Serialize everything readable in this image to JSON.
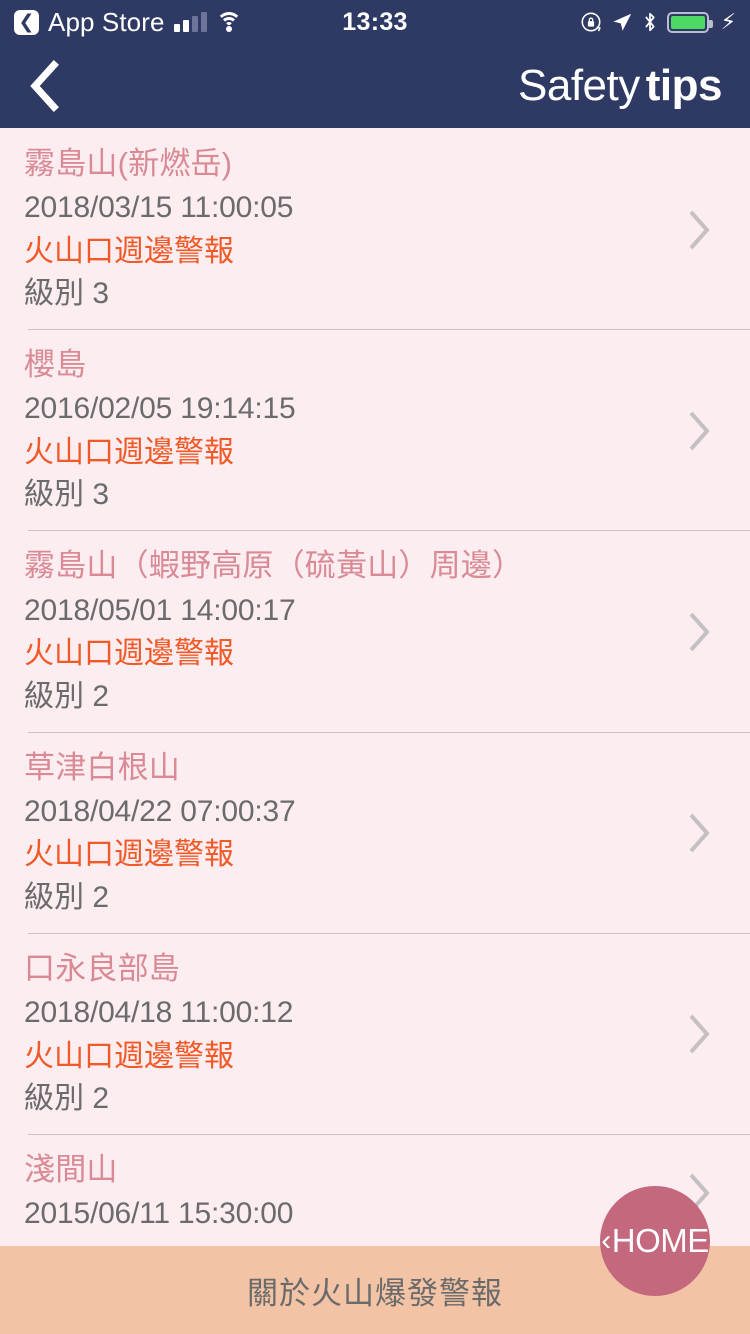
{
  "status_bar": {
    "back_app_label": "App Store",
    "back_chip_icon": "chevron-left-icon",
    "clock": "13:33",
    "signal_icon": "cellular-signal-icon",
    "wifi_icon": "wifi-icon",
    "rotation_lock_icon": "rotation-lock-icon",
    "location_icon": "location-arrow-icon",
    "bluetooth_icon": "bluetooth-icon",
    "battery_icon": "battery-icon",
    "charging_icon": "lightning-bolt-icon",
    "battery_color": "#4cd964",
    "bar_color": "#2e3a63"
  },
  "nav_bar": {
    "back_icon": "chevron-left-icon",
    "title_thin": "Safety",
    "title_bold": "tips",
    "background": "#2e3a63"
  },
  "list": {
    "chevron_icon": "chevron-right-icon",
    "items": [
      {
        "name": "霧島山(新燃岳)",
        "datetime": "2018/03/15 11:00:05",
        "alert": "火山口週邊警報",
        "level": "級別 3"
      },
      {
        "name": "櫻島",
        "datetime": "2016/02/05 19:14:15",
        "alert": "火山口週邊警報",
        "level": "級別 3"
      },
      {
        "name": "霧島山（蝦野高原（硫黃山）周邊）",
        "datetime": "2018/05/01 14:00:17",
        "alert": "火山口週邊警報",
        "level": "級別 2"
      },
      {
        "name": "草津白根山",
        "datetime": "2018/04/22 07:00:37",
        "alert": "火山口週邊警報",
        "level": "級別 2"
      },
      {
        "name": "口永良部島",
        "datetime": "2018/04/18 11:00:12",
        "alert": "火山口週邊警報",
        "level": "級別 2"
      },
      {
        "name": "淺間山",
        "datetime": "2015/06/11 15:30:00",
        "alert": "",
        "level": ""
      }
    ],
    "colors": {
      "background": "#fcedf1",
      "title": "#d98a95",
      "alert": "#ef5a28",
      "text": "#6b6b6b",
      "divider": "#c9c3c6"
    }
  },
  "bottom_bar": {
    "label": "關於火山爆發警報",
    "background": "#f2c3a4",
    "text_color": "#6b6b6b"
  },
  "home_button": {
    "chevron": "‹",
    "label": "HOME",
    "icon": "home-back-icon",
    "background": "#c4687e"
  }
}
